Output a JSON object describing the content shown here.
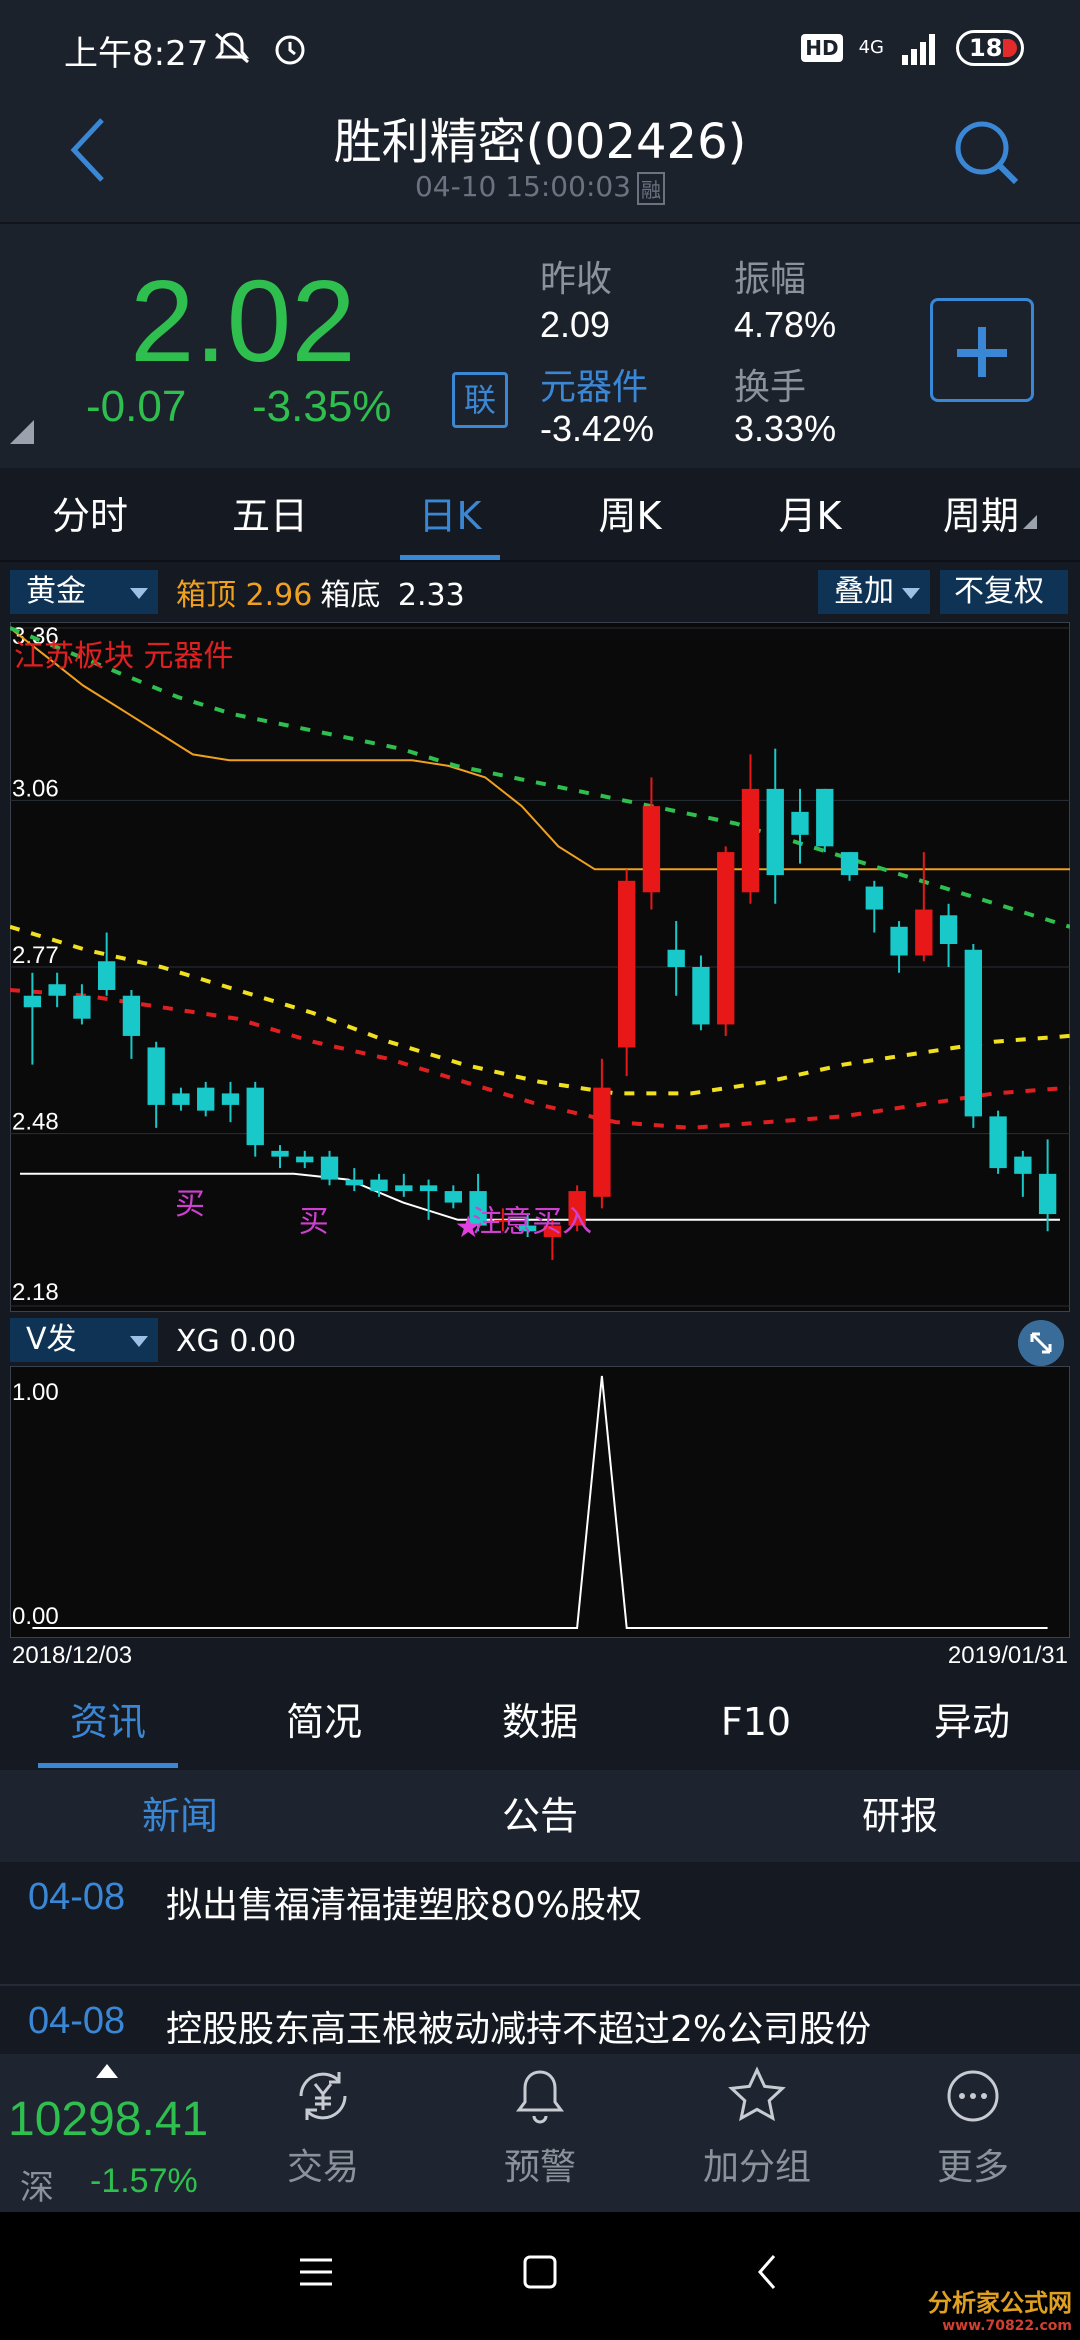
{
  "status_bar": {
    "time": "上午8:27",
    "hd": "HD",
    "net": "4G",
    "battery": "18"
  },
  "header": {
    "title": "胜利精密(002426)",
    "datetime": "04-10 15:00:03",
    "rong": "融"
  },
  "quote": {
    "price": "2.02",
    "change": "-0.07",
    "change_pct": "-3.35%",
    "lian": "联",
    "prev_close_label": "昨收",
    "prev_close": "2.09",
    "amplitude_label": "振幅",
    "amplitude": "4.78%",
    "sector_label": "元器件",
    "sector_change": "-3.42%",
    "turnover_label": "换手",
    "turnover": "3.33%"
  },
  "period_tabs": [
    "分时",
    "五日",
    "日K",
    "周K",
    "月K",
    "周期"
  ],
  "chart_toolbar": {
    "indicator": "黄金",
    "box_top_label": "箱顶",
    "box_top": "2.96",
    "box_bottom_label": "箱底",
    "box_bottom": "2.33",
    "overlay": "叠加",
    "adjust": "不复权"
  },
  "chart_data": [
    {
      "type": "candlestick",
      "title": "",
      "y_ticks": [
        "3.36",
        "3.06",
        "2.77",
        "2.48",
        "2.18"
      ],
      "ylim": [
        2.18,
        3.36
      ],
      "overlay_label": "江苏板块 元器件",
      "annotations": [
        "买",
        "买",
        "注意买入"
      ],
      "candles": [
        {
          "o": 2.72,
          "h": 2.76,
          "l": 2.6,
          "c": 2.7
        },
        {
          "o": 2.74,
          "h": 2.76,
          "l": 2.7,
          "c": 2.72
        },
        {
          "o": 2.72,
          "h": 2.74,
          "l": 2.67,
          "c": 2.68
        },
        {
          "o": 2.78,
          "h": 2.83,
          "l": 2.72,
          "c": 2.73
        },
        {
          "o": 2.72,
          "h": 2.73,
          "l": 2.61,
          "c": 2.65
        },
        {
          "o": 2.63,
          "h": 2.64,
          "l": 2.49,
          "c": 2.53
        },
        {
          "o": 2.55,
          "h": 2.56,
          "l": 2.52,
          "c": 2.53
        },
        {
          "o": 2.56,
          "h": 2.57,
          "l": 2.51,
          "c": 2.52
        },
        {
          "o": 2.55,
          "h": 2.57,
          "l": 2.5,
          "c": 2.53
        },
        {
          "o": 2.56,
          "h": 2.57,
          "l": 2.44,
          "c": 2.46
        },
        {
          "o": 2.45,
          "h": 2.46,
          "l": 2.42,
          "c": 2.44
        },
        {
          "o": 2.44,
          "h": 2.45,
          "l": 2.42,
          "c": 2.43
        },
        {
          "o": 2.44,
          "h": 2.45,
          "l": 2.39,
          "c": 2.4
        },
        {
          "o": 2.4,
          "h": 2.42,
          "l": 2.38,
          "c": 2.39
        },
        {
          "o": 2.4,
          "h": 2.41,
          "l": 2.37,
          "c": 2.38
        },
        {
          "o": 2.39,
          "h": 2.41,
          "l": 2.37,
          "c": 2.38
        },
        {
          "o": 2.39,
          "h": 2.4,
          "l": 2.33,
          "c": 2.38
        },
        {
          "o": 2.38,
          "h": 2.39,
          "l": 2.35,
          "c": 2.36
        },
        {
          "o": 2.38,
          "h": 2.41,
          "l": 2.31,
          "c": 2.32
        },
        {
          "o": 2.33,
          "h": 2.35,
          "l": 2.31,
          "c": 2.33
        },
        {
          "o": 2.32,
          "h": 2.34,
          "l": 2.3,
          "c": 2.31
        },
        {
          "o": 2.3,
          "h": 2.33,
          "l": 2.26,
          "c": 2.32
        },
        {
          "o": 2.32,
          "h": 2.39,
          "l": 2.31,
          "c": 2.38
        },
        {
          "o": 2.37,
          "h": 2.61,
          "l": 2.35,
          "c": 2.56
        },
        {
          "o": 2.63,
          "h": 2.94,
          "l": 2.58,
          "c": 2.92
        },
        {
          "o": 2.9,
          "h": 3.1,
          "l": 2.87,
          "c": 3.05
        },
        {
          "o": 2.8,
          "h": 2.85,
          "l": 2.72,
          "c": 2.77
        },
        {
          "o": 2.77,
          "h": 2.79,
          "l": 2.66,
          "c": 2.67
        },
        {
          "o": 2.67,
          "h": 2.98,
          "l": 2.65,
          "c": 2.97
        },
        {
          "o": 2.9,
          "h": 3.14,
          "l": 2.88,
          "c": 3.08
        },
        {
          "o": 3.08,
          "h": 3.15,
          "l": 2.88,
          "c": 2.93
        },
        {
          "o": 3.04,
          "h": 3.08,
          "l": 2.95,
          "c": 3.0
        },
        {
          "o": 3.08,
          "h": 3.08,
          "l": 2.97,
          "c": 2.98
        },
        {
          "o": 2.97,
          "h": 2.97,
          "l": 2.92,
          "c": 2.93
        },
        {
          "o": 2.91,
          "h": 2.92,
          "l": 2.83,
          "c": 2.87
        },
        {
          "o": 2.84,
          "h": 2.85,
          "l": 2.76,
          "c": 2.79
        },
        {
          "o": 2.79,
          "h": 2.97,
          "l": 2.78,
          "c": 2.87
        },
        {
          "o": 2.86,
          "h": 2.88,
          "l": 2.77,
          "c": 2.81
        },
        {
          "o": 2.8,
          "h": 2.81,
          "l": 2.49,
          "c": 2.51
        },
        {
          "o": 2.51,
          "h": 2.52,
          "l": 2.41,
          "c": 2.42
        },
        {
          "o": 2.44,
          "h": 2.45,
          "l": 2.37,
          "c": 2.41
        },
        {
          "o": 2.41,
          "h": 2.47,
          "l": 2.31,
          "c": 2.34
        }
      ],
      "lines": [
        {
          "name": "",
          "color": "#f0a020",
          "values": [
            3.36,
            3.31,
            3.26,
            3.22,
            3.18,
            3.14,
            3.13,
            3.13,
            3.13,
            3.13,
            3.13,
            3.13,
            3.12,
            3.1,
            3.05,
            2.98,
            2.94,
            2.94,
            2.94,
            2.94,
            2.94,
            2.94,
            2.94,
            2.94,
            2.94,
            2.94,
            2.94,
            2.94,
            2.94,
            2.94
          ]
        },
        {
          "name": "",
          "color": "#2fbf4f",
          "values": [
            3.36,
            3.32,
            3.28,
            3.24,
            3.21,
            3.19,
            3.17,
            3.15,
            3.12,
            3.1,
            3.08,
            3.06,
            3.04,
            3.02,
            2.99,
            2.96,
            2.93,
            2.9,
            2.87,
            2.84
          ]
        },
        {
          "name": "",
          "color": "#f0e020",
          "values": [
            2.84,
            2.8,
            2.77,
            2.73,
            2.69,
            2.64,
            2.6,
            2.57,
            2.55,
            2.55,
            2.57,
            2.6,
            2.62,
            2.64,
            2.65
          ]
        },
        {
          "name": "",
          "color": "#e02020",
          "values": [
            2.73,
            2.72,
            2.7,
            2.68,
            2.64,
            2.61,
            2.57,
            2.53,
            2.5,
            2.49,
            2.5,
            2.51,
            2.53,
            2.55,
            2.56
          ]
        },
        {
          "name": "",
          "color": "#ffffff",
          "values": [
            2.41,
            2.41,
            2.41,
            2.41,
            2.41,
            2.41,
            2.4,
            2.36,
            2.33,
            2.33,
            2.33,
            2.33,
            2.33,
            2.33,
            2.33,
            2.33,
            2.33,
            2.33,
            2.33,
            2.33
          ]
        }
      ]
    },
    {
      "type": "line",
      "title": "",
      "panel_label": "V发",
      "indicator": "XG",
      "indicator_value": "0.00",
      "y_ticks": [
        "1.00",
        "0.00"
      ],
      "ylim": [
        0,
        1
      ],
      "x_ticks": [
        "2018/12/03",
        "2019/01/31"
      ],
      "values": [
        0,
        0,
        0,
        0,
        0,
        0,
        0,
        0,
        0,
        0,
        0,
        0,
        0,
        0,
        0,
        0,
        0,
        0,
        0,
        0,
        0,
        0,
        0,
        1,
        0,
        0,
        0,
        0,
        0,
        0,
        0,
        0,
        0,
        0,
        0,
        0,
        0,
        0,
        0,
        0,
        0,
        0
      ]
    }
  ],
  "info_tabs": [
    "资讯",
    "简况",
    "数据",
    "F10",
    "异动"
  ],
  "sub_tabs": [
    "新闻",
    "公告",
    "研报"
  ],
  "news": [
    {
      "date": "04-08",
      "title": "拟出售福清福捷塑胶80%股权"
    },
    {
      "date": "04-08",
      "title": "控股股东高玉根被动减持不超过2%公司股份"
    }
  ],
  "bottom_bar": {
    "index_value": "10298.41",
    "index_name": "深",
    "index_pct": "-1.57%",
    "nav": [
      {
        "label": "交易",
        "icon": "yuan-exchange-icon"
      },
      {
        "label": "预警",
        "icon": "bell-icon"
      },
      {
        "label": "加分组",
        "icon": "star-icon"
      },
      {
        "label": "更多",
        "icon": "more-dots-icon"
      }
    ]
  },
  "watermark": {
    "text": "分析家公式网",
    "url": "www.70822.com"
  }
}
